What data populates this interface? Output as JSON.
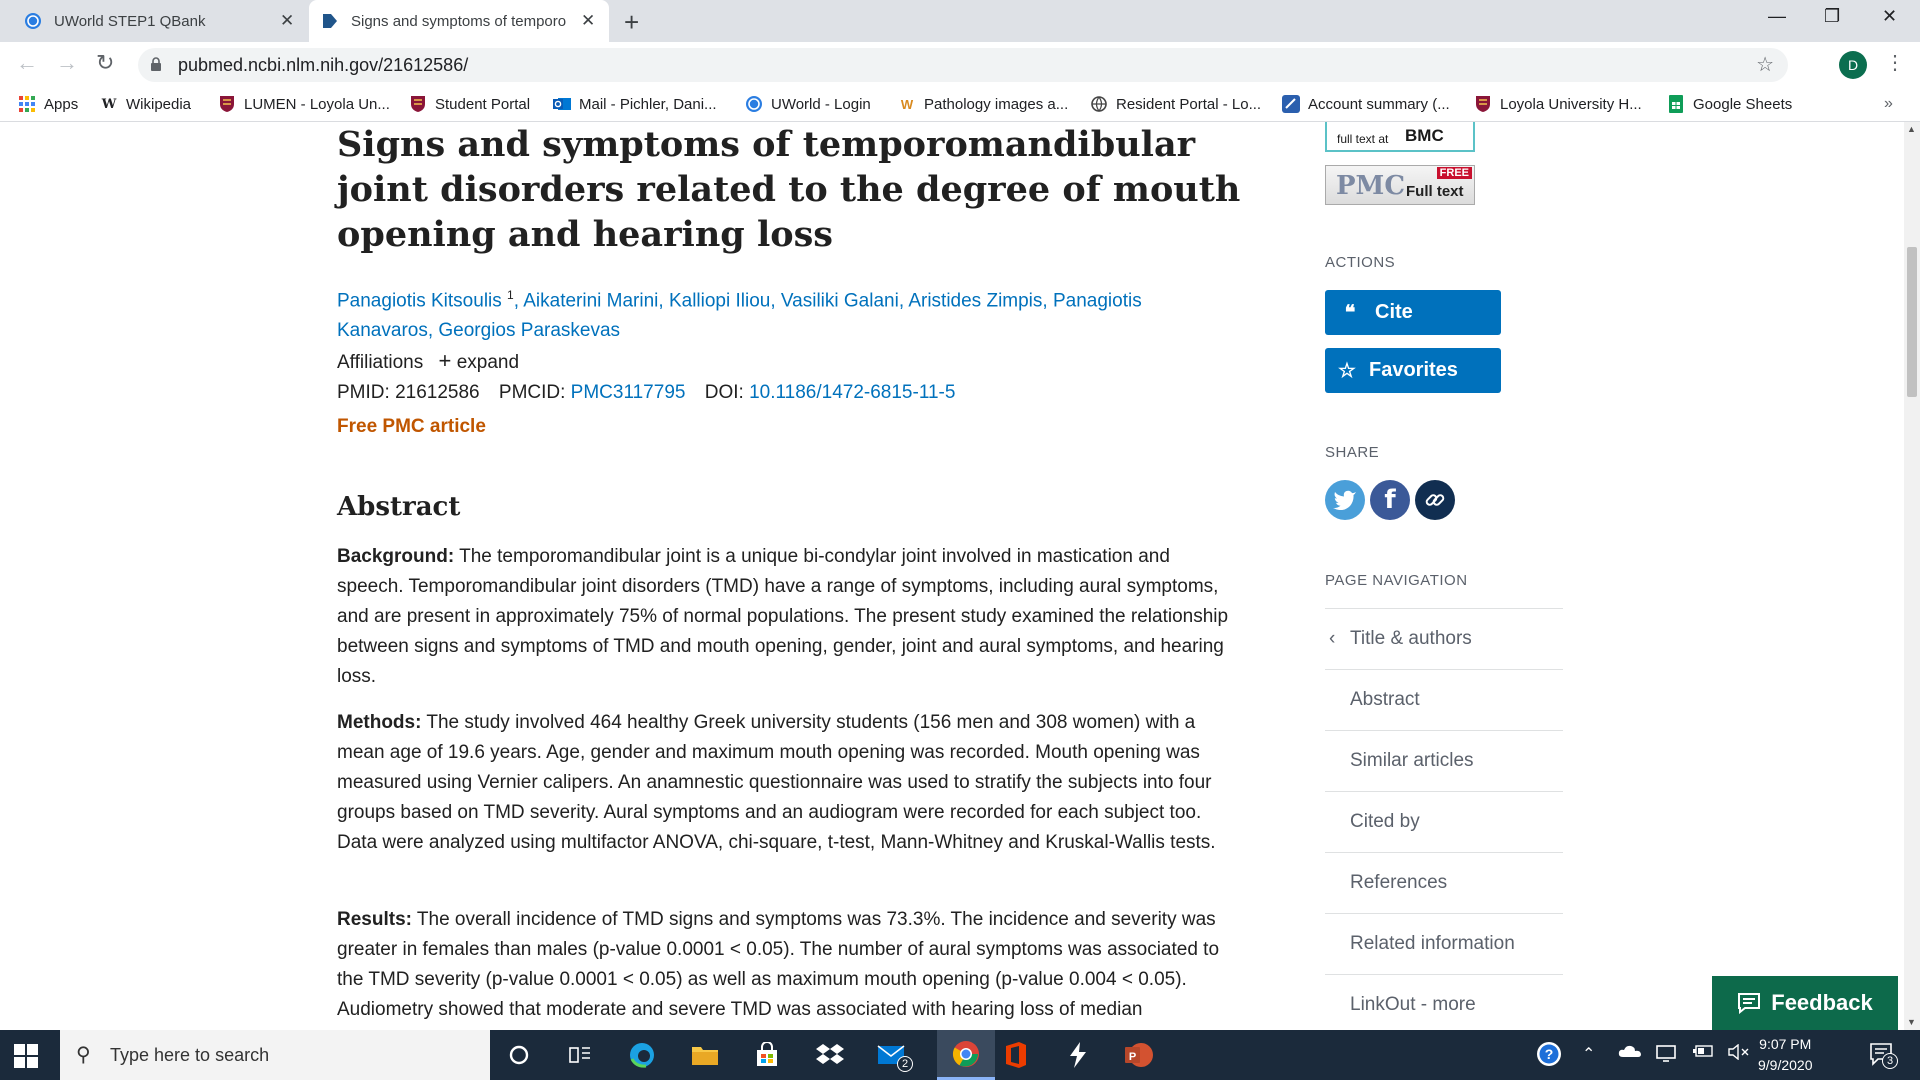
{
  "browser": {
    "tabs": [
      {
        "title": "UWorld STEP1 QBank",
        "active": false
      },
      {
        "title": "Signs and symptoms of temporo",
        "active": true
      }
    ],
    "url": "pubmed.ncbi.nlm.nih.gov/21612586/",
    "profile_initial": "D",
    "bookmarks": [
      {
        "label": "Apps",
        "icon": "apps-grid-icon"
      },
      {
        "label": "Wikipedia",
        "icon": "wikipedia-icon"
      },
      {
        "label": "LUMEN - Loyola Un...",
        "icon": "loyola-crest-icon"
      },
      {
        "label": "Student Portal",
        "icon": "loyola-crest-icon"
      },
      {
        "label": "Mail - Pichler, Dani...",
        "icon": "outlook-icon"
      },
      {
        "label": "UWorld - Login",
        "icon": "uworld-icon"
      },
      {
        "label": "Pathology images a...",
        "icon": "pathology-icon"
      },
      {
        "label": "Resident Portal - Lo...",
        "icon": "globe-icon"
      },
      {
        "label": "Account summary (...",
        "icon": "account-icon"
      },
      {
        "label": "Loyola University H...",
        "icon": "loyola-crest-icon"
      },
      {
        "label": "Google Sheets",
        "icon": "google-sheets-icon"
      }
    ]
  },
  "article": {
    "title": "Signs and symptoms of temporomandibular joint disorders related to the degree of mouth opening and hearing loss",
    "authors_line1_a": "Panagiotis Kitsoulis",
    "authors_sup": "1",
    "authors_line1_b": ", Aikaterini Marini, Kalliopi Iliou, Vasiliki Galani, Aristides Zimpis, Panagiotis",
    "authors_line2": "Kanavaros, Georgios Paraskevas",
    "affiliations_label": "Affiliations",
    "expand_label": "expand",
    "pmid_label": "PMID:",
    "pmid": "21612586",
    "pmcid_label": "PMCID:",
    "pmcid": "PMC3117795",
    "doi_label": "DOI:",
    "doi": "10.1186/1472-6815-11-5",
    "free_pmc": "Free PMC article",
    "abstract_heading": "Abstract",
    "background_label": "Background:",
    "background_text": " The temporomandibular joint is a unique bi-condylar joint involved in mastication and speech. Temporomandibular joint disorders (TMD) have a range of symptoms, including aural symptoms, and are present in approximately 75% of normal populations. The present study examined the relationship between signs and symptoms of TMD and mouth opening, gender, joint and aural symptoms, and hearing loss.",
    "methods_label": "Methods:",
    "methods_text": " The study involved 464 healthy Greek university students (156 men and 308 women) with a mean age of 19.6 years. Age, gender and maximum mouth opening was recorded. Mouth opening was measured using Vernier calipers. An anamnestic questionnaire was used to stratify the subjects into four groups based on TMD severity. Aural symptoms and an audiogram were recorded for each subject too. Data were analyzed using multifactor ANOVA, chi-square, t-test, Mann-Whitney and Kruskal-Wallis tests.",
    "results_label": "Results:",
    "results_text": " The overall incidence of TMD signs and symptoms was 73.3%. The incidence and severity was greater in females than males (p-value 0.0001 < 0.05). The number of aural symptoms was associated to the TMD severity (p-value 0.0001 < 0.05) as well as maximum mouth opening (p-value 0.004 < 0.05). Audiometry showed that moderate and severe TMD was associated with hearing loss of median"
  },
  "sidebar": {
    "bmc_text": "full text at",
    "bmc_brand": "BMC",
    "pmc_brand": "PMC",
    "pmc_free": "FREE",
    "pmc_full": "Full text",
    "actions_heading": "ACTIONS",
    "cite_label": "Cite",
    "favorites_label": "Favorites",
    "share_heading": "SHARE",
    "page_nav_heading": "PAGE NAVIGATION",
    "nav_items": [
      "Title & authors",
      "Abstract",
      "Similar articles",
      "Cited by",
      "References",
      "Related information",
      "LinkOut - more"
    ]
  },
  "feedback_label": "Feedback",
  "taskbar": {
    "search_placeholder": "Type here to search",
    "time": "9:07 PM",
    "date": "9/9/2020",
    "mail_badge": "2",
    "notification_count": "3"
  }
}
